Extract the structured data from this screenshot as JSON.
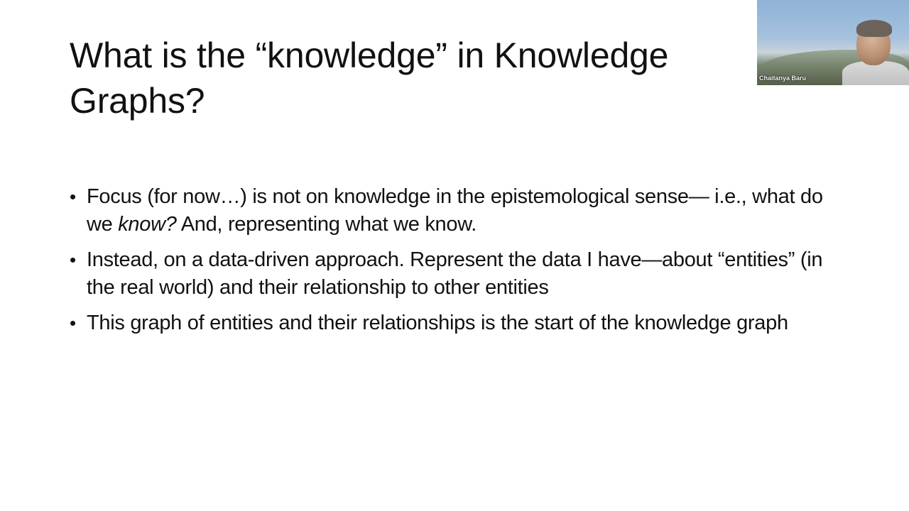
{
  "slide": {
    "title": "What is the “knowledge” in Knowledge Graphs?",
    "bullet_symbol": "•",
    "bullets": [
      {
        "before": "Focus (for now…) is not on knowledge in the epistemological sense— i.e., what do we ",
        "emphasis": "know?",
        "after": " And, representing what we know."
      },
      {
        "text": "Instead, on a data-driven approach. Represent the data I have—about “entities” (in the real world) and their relationship to other entities"
      },
      {
        "text": "This graph of entities and their relationships is the start of the knowledge graph"
      }
    ]
  },
  "video_tile": {
    "participant_name": "Chaitanya Baru"
  }
}
